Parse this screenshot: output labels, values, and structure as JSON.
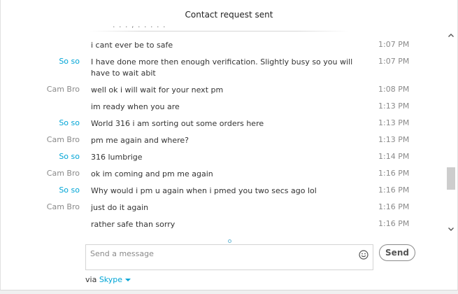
{
  "header": {
    "title": "Contact request sent"
  },
  "messages": [
    {
      "sender": "",
      "text": "i cant ever be to safe",
      "time": "1:07 PM",
      "self": false
    },
    {
      "sender": "So so",
      "text": "I have done more then enough verification. Slightly busy so you will have to wait abit",
      "time": "1:07 PM",
      "self": true
    },
    {
      "sender": "Cam Bro",
      "text": "well ok i will wait for your next pm",
      "time": "1:08 PM",
      "self": false
    },
    {
      "sender": "",
      "text": "im ready when you are",
      "time": "1:13 PM",
      "self": false
    },
    {
      "sender": "So so",
      "text": "World 316 i am sorting out some orders here",
      "time": "1:13 PM",
      "self": true
    },
    {
      "sender": "Cam Bro",
      "text": "pm me again and where?",
      "time": "1:13 PM",
      "self": false
    },
    {
      "sender": "So so",
      "text": "316 lumbrige",
      "time": "1:14 PM",
      "self": true
    },
    {
      "sender": "Cam Bro",
      "text": "ok im coming and pm me again",
      "time": "1:16 PM",
      "self": false
    },
    {
      "sender": "So so",
      "text": "Why would i pm u again when i pmed you two secs ago lol",
      "time": "1:16 PM",
      "self": true
    },
    {
      "sender": "Cam Bro",
      "text": "just do it again",
      "time": "1:16 PM",
      "self": false
    },
    {
      "sender": "",
      "text": "rather safe than sorry",
      "time": "1:16 PM",
      "self": false
    }
  ],
  "compose": {
    "placeholder": "Send a message",
    "value": ""
  },
  "send_label": "Send",
  "via": {
    "prefix": "via",
    "service": "Skype"
  },
  "icons": {
    "emoji": "smiley-icon",
    "scroll_up": "chevron-up-icon",
    "scroll_down": "chevron-down-icon",
    "service_dropdown": "caret-down-icon"
  },
  "colors": {
    "self_sender": "#00a5d6",
    "other_sender": "#8a8a8a",
    "link": "#00a5d6"
  }
}
